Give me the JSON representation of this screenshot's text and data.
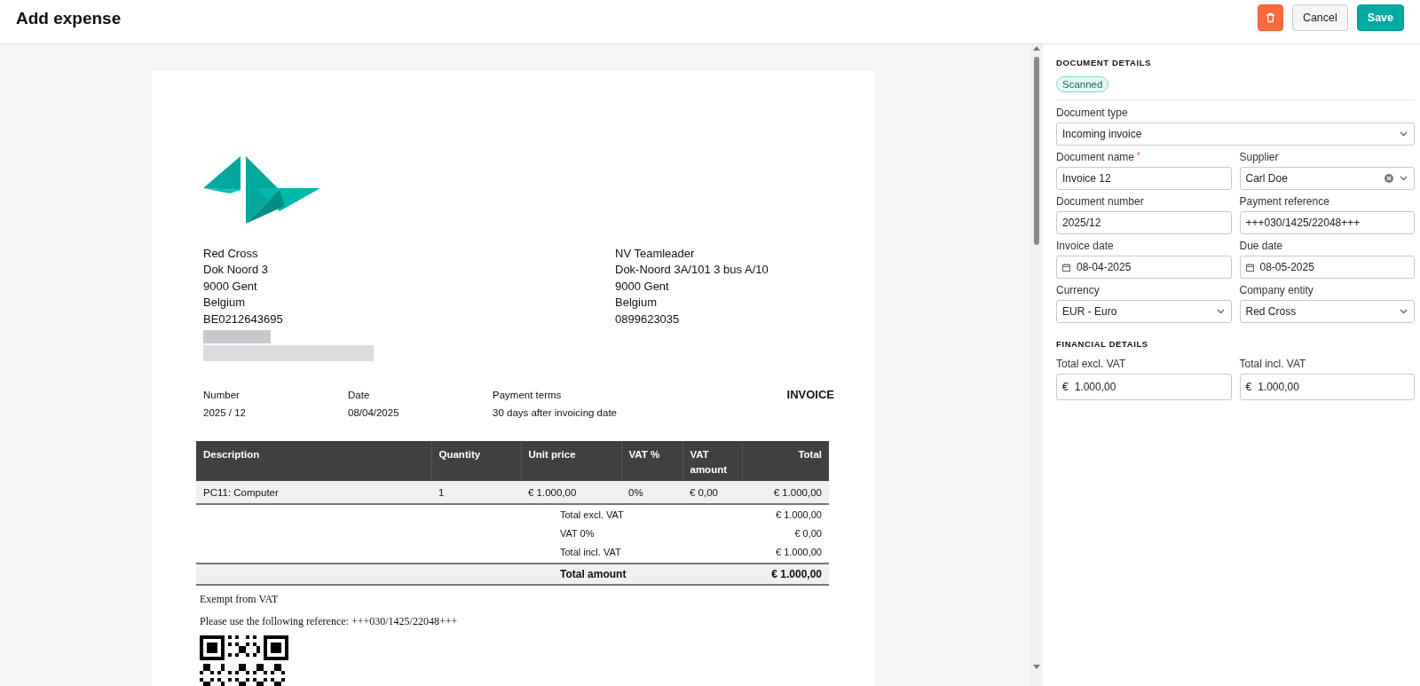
{
  "header": {
    "title": "Add expense",
    "buttons": [
      {
        "kind": "delete"
      },
      {
        "kind": "cancel",
        "label": "Cancel"
      },
      {
        "kind": "save",
        "label": "Save"
      }
    ]
  },
  "document": {
    "sender": [
      "Red Cross",
      "Dok Noord 3",
      "9000 Gent",
      "Belgium",
      "BE0212643695"
    ],
    "recipient": [
      "NV Teamleader",
      "Dok-Noord 3A/101 3 bus A/10",
      "9000 Gent",
      "Belgium",
      "0899623035"
    ],
    "meta": [
      {
        "label": "Number",
        "value": "2025 / 12"
      },
      {
        "label": "Date",
        "value": "08/04/2025"
      },
      {
        "label": "Payment terms",
        "value": "30 days after invoicing date"
      }
    ],
    "doc_title": "INVOICE",
    "table": {
      "columns": [
        "Description",
        "Quantity",
        "Unit price",
        "VAT %",
        "VAT amount",
        "Total"
      ],
      "rows": [
        [
          "PC11: Computer",
          "1",
          "€ 1.000,00",
          "0%",
          "€ 0,00",
          "€ 1.000,00"
        ]
      ]
    },
    "totals": [
      {
        "label": "Total excl. VAT",
        "value": "€ 1.000,00"
      },
      {
        "label": "VAT 0%",
        "value": "€ 0,00"
      },
      {
        "label": "Total incl. VAT",
        "value": "€ 1.000,00"
      }
    ],
    "total_amount": {
      "label": "Total amount",
      "value": "€ 1.000,00"
    },
    "notes": [
      "Exempt from VAT",
      "Please use the following reference: +++030/1425/22048+++"
    ]
  },
  "panel": {
    "sections": [
      {
        "heading": "DOCUMENT DETAILS",
        "badge": "Scanned",
        "rows": [
          [
            {
              "label": "Document type",
              "kind": "select",
              "value": "Incoming invoice"
            }
          ],
          [
            {
              "label": "Document name",
              "required_mark": "*",
              "kind": "text",
              "value": "Invoice 12"
            },
            {
              "label": "Supplier",
              "kind": "combo",
              "value": "Carl Doe"
            }
          ],
          [
            {
              "label": "Document number",
              "kind": "text",
              "value": "2025/12"
            },
            {
              "label": "Payment reference",
              "kind": "text",
              "value": "+++030/1425/22048+++"
            }
          ],
          [
            {
              "label": "Invoice date",
              "kind": "date",
              "value": "08-04-2025"
            },
            {
              "label": "Due date",
              "kind": "date",
              "value": "08-05-2025"
            }
          ],
          [
            {
              "label": "Currency",
              "kind": "select",
              "value": "EUR - Euro"
            },
            {
              "label": "Company entity",
              "kind": "select",
              "value": "Red Cross"
            }
          ]
        ]
      },
      {
        "heading": "FINANCIAL DETAILS",
        "rows": [
          [
            {
              "label": "Total excl. VAT",
              "kind": "money",
              "symbol": "€",
              "value": "1.000,00"
            },
            {
              "label": "Total incl. VAT",
              "kind": "money",
              "symbol": "€",
              "value": "1.000,00"
            }
          ]
        ]
      }
    ]
  }
}
